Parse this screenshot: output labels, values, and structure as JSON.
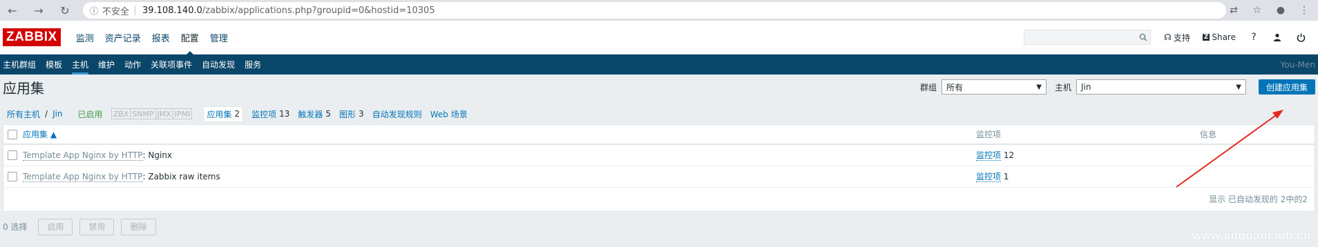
{
  "browser": {
    "insecure_label": "不安全",
    "url_host": "39.108.140.0",
    "url_path": "/zabbix/applications.php?groupid=0&hostid=10305"
  },
  "header": {
    "logo": "ZABBIX",
    "menu": [
      "监测",
      "资产记录",
      "报表",
      "配置",
      "管理"
    ],
    "active_menu": "配置",
    "support_label": "支持",
    "share_label": "Share",
    "help_label": "?"
  },
  "submenu": {
    "items": [
      "主机群组",
      "模板",
      "主机",
      "维护",
      "动作",
      "关联项事件",
      "自动发现",
      "服务"
    ],
    "active": "主机",
    "user": "You-Men"
  },
  "page": {
    "title": "应用集",
    "group_label": "群组",
    "group_value": "所有",
    "host_label": "主机",
    "host_value": "Jin",
    "create_button": "创建应用集"
  },
  "subnav": {
    "all_hosts": "所有主机",
    "host": "Jin",
    "status": "已启用",
    "protocols": [
      "ZBX",
      "SNMP",
      "JMX",
      "IPMI"
    ],
    "tabs": [
      {
        "label": "应用集",
        "count": "2",
        "active": true
      },
      {
        "label": "监控项",
        "count": "13"
      },
      {
        "label": "触发器",
        "count": "5"
      },
      {
        "label": "图形",
        "count": "3"
      },
      {
        "label": "自动发现规则",
        "count": ""
      },
      {
        "label": "Web 场景",
        "count": ""
      }
    ]
  },
  "table": {
    "columns": [
      "应用集 ▲",
      "监控项",
      "信息"
    ],
    "rows": [
      {
        "template": "Template App Nginx by HTTP",
        "name": ": Nginx",
        "items_label": "监控项",
        "items_count": "12"
      },
      {
        "template": "Template App Nginx by HTTP",
        "name": ": Zabbix raw items",
        "items_label": "监控项",
        "items_count": "1"
      }
    ],
    "footer": "显示 已自动发现的 2中的2"
  },
  "actions": {
    "selected": "0 选择",
    "enable": "启用",
    "disable": "禁用",
    "delete": "删除"
  },
  "watermark": "www.anquanclub.cn",
  "colors": {
    "brand_red": "#d40000",
    "nav_blue": "#0a466a",
    "link_blue": "#0275b8",
    "annotation_red": "#e8251f"
  }
}
